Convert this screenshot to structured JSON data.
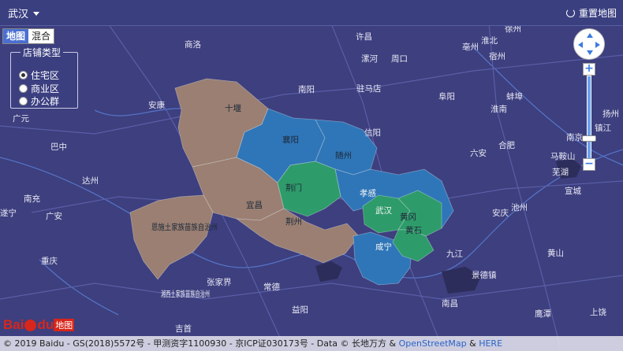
{
  "topbar": {
    "city": "武汉",
    "reset_label": "重置地图"
  },
  "map_type": {
    "options": [
      "地图",
      "混合"
    ],
    "selected": "地图"
  },
  "legend": {
    "title": "店铺类型",
    "items": [
      "住宅区",
      "商业区",
      "办公群"
    ],
    "selected": "住宅区"
  },
  "colors": {
    "background": "#3d3f7e",
    "tier_brown": "#9a7f72",
    "tier_blue": "#2f76b8",
    "tier_green": "#2e9b6a",
    "road": "#585ba6",
    "river": "#4f7fd1"
  },
  "regions": [
    {
      "name": "十堰",
      "tier": "brown"
    },
    {
      "name": "恩施土家族苗族自治州",
      "tier": "brown"
    },
    {
      "name": "宜昌",
      "tier": "brown"
    },
    {
      "name": "荆州",
      "tier": "brown"
    },
    {
      "name": "襄阳",
      "tier": "blue"
    },
    {
      "name": "随州",
      "tier": "blue"
    },
    {
      "name": "孝感",
      "tier": "blue"
    },
    {
      "name": "咸宁",
      "tier": "blue"
    },
    {
      "name": "荆门",
      "tier": "green"
    },
    {
      "name": "武汉",
      "tier": "green"
    },
    {
      "name": "黄冈",
      "tier": "green"
    },
    {
      "name": "黄石",
      "tier": "green"
    }
  ],
  "place_labels": [
    "南阳",
    "许昌",
    "漯河",
    "周口",
    "亳州",
    "淮北",
    "宿州",
    "徐州",
    "商洛",
    "驻马店",
    "阜阳",
    "蚌埠",
    "安康",
    "信阳",
    "淮南",
    "南京",
    "扬州",
    "镇江",
    "广元",
    "巴中",
    "六安",
    "合肥",
    "马鞍山",
    "芜湖",
    "达州",
    "宣城",
    "南充",
    "池州",
    "遂宁",
    "广安",
    "安庆",
    "重庆",
    "九江",
    "黄山",
    "张家界",
    "常德",
    "景德镇",
    "湘西土家族苗族自治州",
    "益阳",
    "吉首",
    "南昌",
    "上饶",
    "鹰潭"
  ],
  "attribution": {
    "text": "© 2019 Baidu - GS(2018)5572号 - 甲测资字1100930 - 京ICP证030173号 - Data © 长地万方 & ",
    "link1": "OpenStreetMap",
    "sep": " & ",
    "link2": "HERE"
  },
  "logo": {
    "text_bai": "Bai",
    "text_du": "du",
    "text_map": "地图"
  }
}
